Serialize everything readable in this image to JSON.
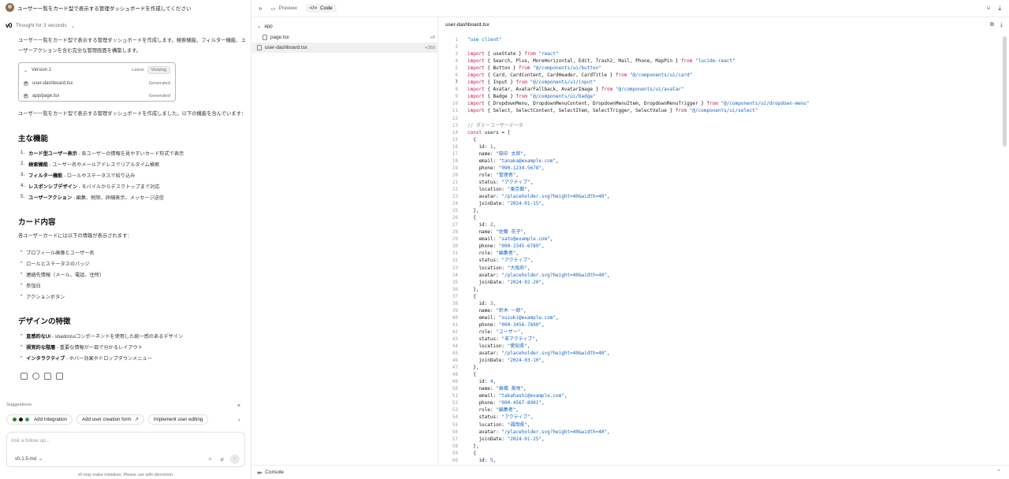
{
  "chat": {
    "prompt": "ユーザー一覧をカード型で表示する管理ダッシュボードを作成してください",
    "thought": "Thought for 3 seconds",
    "intro": "ユーザー一覧をカード型で表示する管理ダッシュボードを作成します。検索機能、フィルター機能、ユーザーアクションを含む完全な管理画面を構築します。",
    "version": {
      "title": "Version 1",
      "latest": "Latest",
      "viewing": "Viewing",
      "files": [
        {
          "name": "user-dashboard.tsx",
          "status": "Generated"
        },
        {
          "name": "app/page.tsx",
          "status": "Generated"
        }
      ]
    },
    "summary": "ユーザー一覧をカード型で表示する管理ダッシュボードを作成しました。以下の機能を含んでいます：",
    "section1": {
      "title": "主な機能",
      "items": [
        {
          "n": "1.",
          "b": "カード型ユーザー表示",
          "t": " - 各ユーザーの情報を見やすいカード形式で表示"
        },
        {
          "n": "2.",
          "b": "検索機能",
          "t": " - ユーザー名やメールアドレスでリアルタイム検索"
        },
        {
          "n": "3.",
          "b": "フィルター機能",
          "t": " - ロールやステータスで絞り込み"
        },
        {
          "n": "4.",
          "b": "レスポンシブデザイン",
          "t": " - モバイルからデスクトップまで対応"
        },
        {
          "n": "5.",
          "b": "ユーザーアクション",
          "t": " - 編集、削除、詳細表示、メッセージ送信"
        }
      ]
    },
    "section2": {
      "title": "カード内容",
      "desc": "各ユーザーカードには以下の情報が表示されます：",
      "items": [
        "プロフィール画像とユーザー名",
        "ロールとステータスのバッジ",
        "連絡先情報（メール、電話、住所）",
        "参加日",
        "アクションボタン"
      ]
    },
    "section3": {
      "title": "デザインの特徴",
      "items": [
        {
          "b": "直感的なUI",
          "t": " - shadcn/uiコンポーネントを使用した統一感のあるデザイン"
        },
        {
          "b": "視覚的な階層",
          "t": " - 重要な情報が一目で分かるレイアウト"
        },
        {
          "b": "インタラクティブ",
          "t": " - ホバー効果やドロップダウンメニュー"
        }
      ]
    },
    "suggestions": {
      "title": "Suggestions",
      "items": [
        "Add Integration",
        "Add user creation form",
        "Implement user editing"
      ]
    },
    "input_placeholder": "Ask a follow up...",
    "model": "v0-1.5-md",
    "disclaimer": "v0 may make mistakes. Please use with discretion."
  },
  "topbar": {
    "preview": "Preview",
    "code": "Code"
  },
  "tree": {
    "folder": "app",
    "files": [
      {
        "name": "page.tsx",
        "count": "+6"
      },
      {
        "name": "user-dashboard.tsx",
        "count": "+260"
      }
    ]
  },
  "editor": {
    "filename": "user-dashboard.tsx",
    "current_line": 7,
    "lines": [
      "\"use client\"",
      "",
      "import { useState } from \"react\"",
      "import { Search, Plus, MoreHorizontal, Edit, Trash2, Mail, Phone, MapPin } from \"lucide-react\"",
      "import { Button } from \"@/components/ui/button\"",
      "import { Card, CardContent, CardHeader, CardTitle } from \"@/components/ui/card\"",
      "import { Input } from \"@/components/ui/input\"",
      "import { Avatar, AvatarFallback, AvatarImage } from \"@/components/ui/avatar\"",
      "import { Badge } from \"@/components/ui/badge\"",
      "import { DropdownMenu, DropdownMenuContent, DropdownMenuItem, DropdownMenuTrigger } from \"@/components/ui/dropdown-menu\"",
      "import { Select, SelectContent, SelectItem, SelectTrigger, SelectValue } from \"@/components/ui/select\"",
      "",
      "// ダミーユーザーデータ",
      "const users = [",
      "  {",
      "    id: 1,",
      "    name: \"田中 太郎\",",
      "    email: \"tanaka@example.com\",",
      "    phone: \"090-1234-5678\",",
      "    role: \"管理者\",",
      "    status: \"アクティブ\",",
      "    location: \"東京都\",",
      "    avatar: \"/placeholder.svg?height=40&width=40\",",
      "    joinDate: \"2024-01-15\",",
      "  },",
      "  {",
      "    id: 2,",
      "    name: \"佐藤 花子\",",
      "    email: \"sato@example.com\",",
      "    phone: \"090-2345-6789\",",
      "    role: \"編集者\",",
      "    status: \"アクティブ\",",
      "    location: \"大阪府\",",
      "    avatar: \"/placeholder.svg?height=40&width=40\",",
      "    joinDate: \"2024-02-20\",",
      "  },",
      "  {",
      "    id: 3,",
      "    name: \"鈴木 一郎\",",
      "    email: \"suzuki@example.com\",",
      "    phone: \"090-3456-7890\",",
      "    role: \"ユーザー\",",
      "    status: \"非アクティブ\",",
      "    location: \"愛知県\",",
      "    avatar: \"/placeholder.svg?height=40&width=40\",",
      "    joinDate: \"2024-03-10\",",
      "  },",
      "  {",
      "    id: 4,",
      "    name: \"高橋 美咲\",",
      "    email: \"takahashi@example.com\",",
      "    phone: \"090-4567-8901\",",
      "    role: \"編集者\",",
      "    status: \"アクティブ\",",
      "    location: \"福岡県\",",
      "    avatar: \"/placeholder.svg?height=40&width=40\",",
      "    joinDate: \"2024-01-25\",",
      "  },",
      "  {",
      "    id: 5,"
    ]
  },
  "console": {
    "label": "Console"
  },
  "colors": {
    "keyword": "#c2185b",
    "string": "#1565c0",
    "comment": "#8a8a8a",
    "added": "#4a9a4a"
  }
}
